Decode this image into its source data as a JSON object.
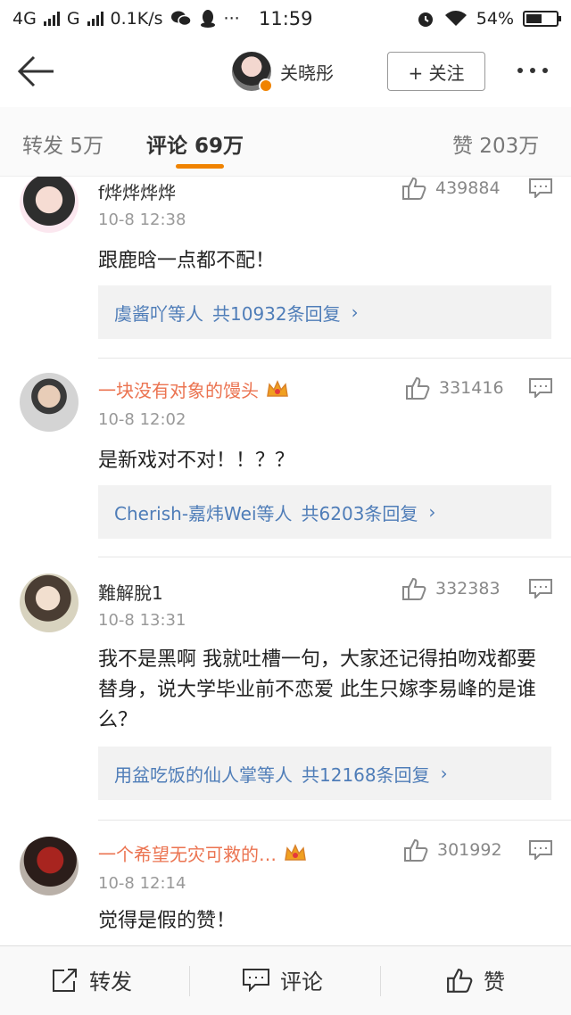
{
  "status_bar": {
    "network_1": "4G",
    "network_2": "G",
    "speed": "0.1K/s",
    "time": "11:59",
    "battery": "54%",
    "battery_level": 0.54
  },
  "nav": {
    "user_name": "关晓彤",
    "follow_label": "+ 关注"
  },
  "tabs": {
    "repost": "转发 5万",
    "comments": "评论 69万",
    "likes": "赞 203万"
  },
  "comments": [
    {
      "name": "f烨烨烨烨",
      "vip": false,
      "time": "10-8 12:38",
      "likes": "439884",
      "text": "跟鹿晗一点都不配！",
      "reply_who": "虞酱吖等人",
      "reply_total": "共10932条回复"
    },
    {
      "name": "一块没有对象的馒头",
      "vip": true,
      "time": "10-8 12:02",
      "likes": "331416",
      "text": "是新戏对不对！！？？",
      "reply_who": "Cherish-嘉炜Wei等人",
      "reply_total": "共6203条回复"
    },
    {
      "name": "難解脫1",
      "vip": false,
      "time": "10-8 13:31",
      "likes": "332383",
      "text": "我不是黑啊 我就吐槽一句，大家还记得拍吻戏都要替身，说大学毕业前不恋爱 此生只嫁李易峰的是谁么？",
      "reply_who": "用盆吃饭的仙人掌等人",
      "reply_total": "共12168条回复"
    },
    {
      "name": "一个希望无灾可救的…",
      "vip": true,
      "time": "10-8 12:14",
      "likes": "301992",
      "text": "觉得是假的赞！"
    }
  ],
  "bottom_bar": {
    "repost": "转发",
    "comment": "评论",
    "like": "赞"
  },
  "colors": {
    "accent": "#f08300",
    "vip_name": "#eb7350",
    "link": "#4f7db8"
  },
  "icons": [
    "back-arrow-icon",
    "alarm-icon",
    "wifi-icon",
    "battery-icon",
    "thumbs-up-icon",
    "comment-icon",
    "crown-icon",
    "share-icon",
    "more-icon"
  ]
}
